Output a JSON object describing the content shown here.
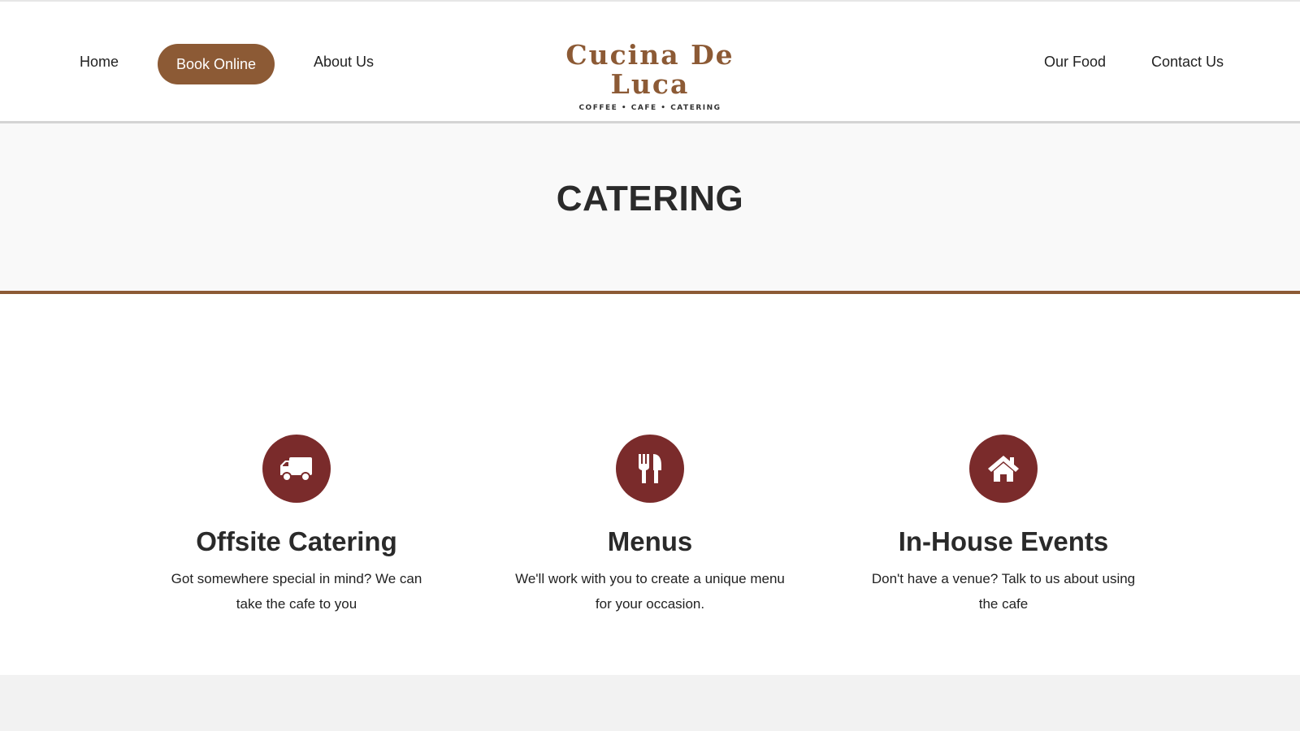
{
  "nav": {
    "home": "Home",
    "book_online": "Book Online",
    "about": "About Us",
    "our_food": "Our Food",
    "contact": "Contact Us"
  },
  "logo": {
    "name": "Cucina De Luca",
    "tagline": "COFFEE • CAFE • CATERING"
  },
  "hero": {
    "title": "CATERING"
  },
  "features": [
    {
      "icon": "truck-icon",
      "title": "Offsite Catering",
      "description": "Got somewhere special in mind? We can take the cafe to you"
    },
    {
      "icon": "utensils-icon",
      "title": "Menus",
      "description": "We'll work with you to create a unique menu for your occasion."
    },
    {
      "icon": "home-icon",
      "title": "In-House Events",
      "description": "Don't have a venue? Talk to us about using the cafe"
    }
  ],
  "colors": {
    "brand_brown": "#8c5a35",
    "icon_maroon": "#7a2b2b",
    "hero_bg": "#f9f9f9"
  }
}
